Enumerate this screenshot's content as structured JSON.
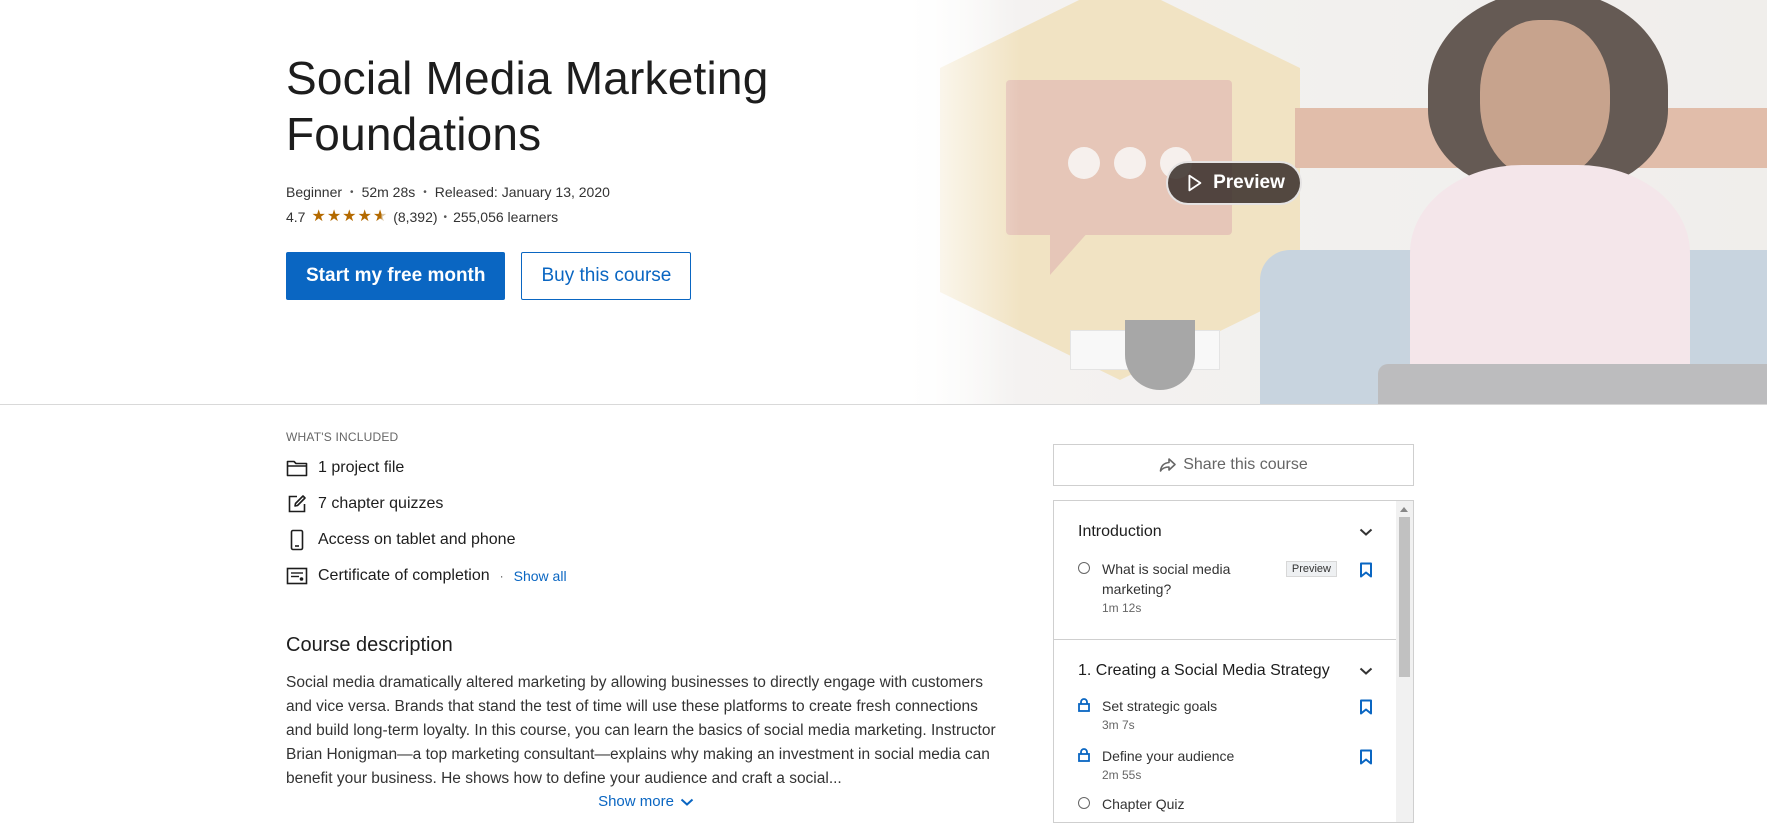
{
  "hero": {
    "title_line1": "Social Media Marketing",
    "title_line2": "Foundations",
    "level": "Beginner",
    "duration": "52m 28s",
    "released": "Released: January 13, 2020",
    "rating": "4.7",
    "rating_value": 4.7,
    "rating_count": "(8,392)",
    "learners": "255,056 learners",
    "primary_cta": "Start my free month",
    "secondary_cta": "Buy this course",
    "preview_label": "Preview",
    "star_color": "#b46a00"
  },
  "included": {
    "label": "WHAT'S INCLUDED",
    "items": [
      {
        "icon": "folder-icon",
        "text": "1 project file"
      },
      {
        "icon": "edit-icon",
        "text": "7 chapter quizzes"
      },
      {
        "icon": "mobile-icon",
        "text": "Access on tablet and phone"
      },
      {
        "icon": "certificate-icon",
        "text": "Certificate of completion"
      }
    ],
    "show_all": "Show all"
  },
  "description": {
    "heading": "Course description",
    "text": "Social media dramatically altered marketing by allowing businesses to directly engage with customers and vice versa. Brands that stand the test of time will use these platforms to create fresh connections and build long-term loyalty. In this course, you can learn the basics of social media marketing. Instructor Brian Honigman—a top marketing consultant—explains why making an investment in social media can benefit your business. He shows how to define your audience and craft a social...",
    "show_more": "Show more"
  },
  "sidebar": {
    "share_label": "Share this course",
    "chapters": [
      {
        "title": "Introduction",
        "lessons": [
          {
            "title": "What is social media marketing?",
            "duration": "1m 12s",
            "badge": "Preview",
            "locked": false
          }
        ]
      },
      {
        "title": "1. Creating a Social Media Strategy",
        "lessons": [
          {
            "title": "Set strategic goals",
            "duration": "3m 7s",
            "locked": true
          },
          {
            "title": "Define your audience",
            "duration": "2m 55s",
            "locked": true
          },
          {
            "title": "Chapter Quiz",
            "duration": "",
            "locked": false
          }
        ]
      }
    ]
  },
  "colors": {
    "accent": "#0a66c2",
    "text": "#1d1d1d"
  }
}
